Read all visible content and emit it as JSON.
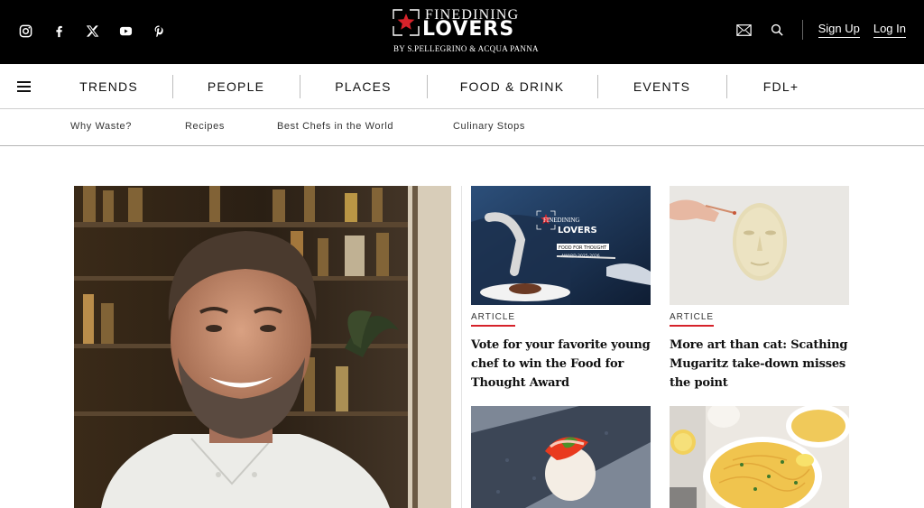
{
  "brand": {
    "name_top": "FINEDINING",
    "name_main": "LOVERS",
    "tagline": "BY S.PELLEGRINO & ACQUA PANNA",
    "accent": "#d6222a"
  },
  "social": [
    {
      "icon": "instagram-icon"
    },
    {
      "icon": "facebook-icon"
    },
    {
      "icon": "x-icon"
    },
    {
      "icon": "youtube-icon"
    },
    {
      "icon": "pinterest-icon"
    }
  ],
  "header_tools": {
    "newsletter_icon": "envelope-icon",
    "search_icon": "search-icon",
    "signup_label": "Sign Up",
    "login_label": "Log In"
  },
  "nav": {
    "menu_icon": "hamburger-menu-icon",
    "items": [
      "TRENDS",
      "PEOPLE",
      "PLACES",
      "FOOD & DRINK",
      "EVENTS",
      "FDL+"
    ]
  },
  "subnav": {
    "items": [
      "Why Waste?",
      "Recipes",
      "Best Chefs in the World",
      "Culinary Stops"
    ]
  },
  "cards": [
    {
      "tag": "ARTICLE",
      "title": "Vote for your favorite young chef to win the Food for Thought Award",
      "thumb_caption": "FOOD FOR THOUGHT",
      "thumb_sub": "AWARD 2025-2026"
    },
    {
      "tag": "ARTICLE",
      "title": "More art than cat: Scathing Mugaritz take-down misses the point"
    }
  ]
}
